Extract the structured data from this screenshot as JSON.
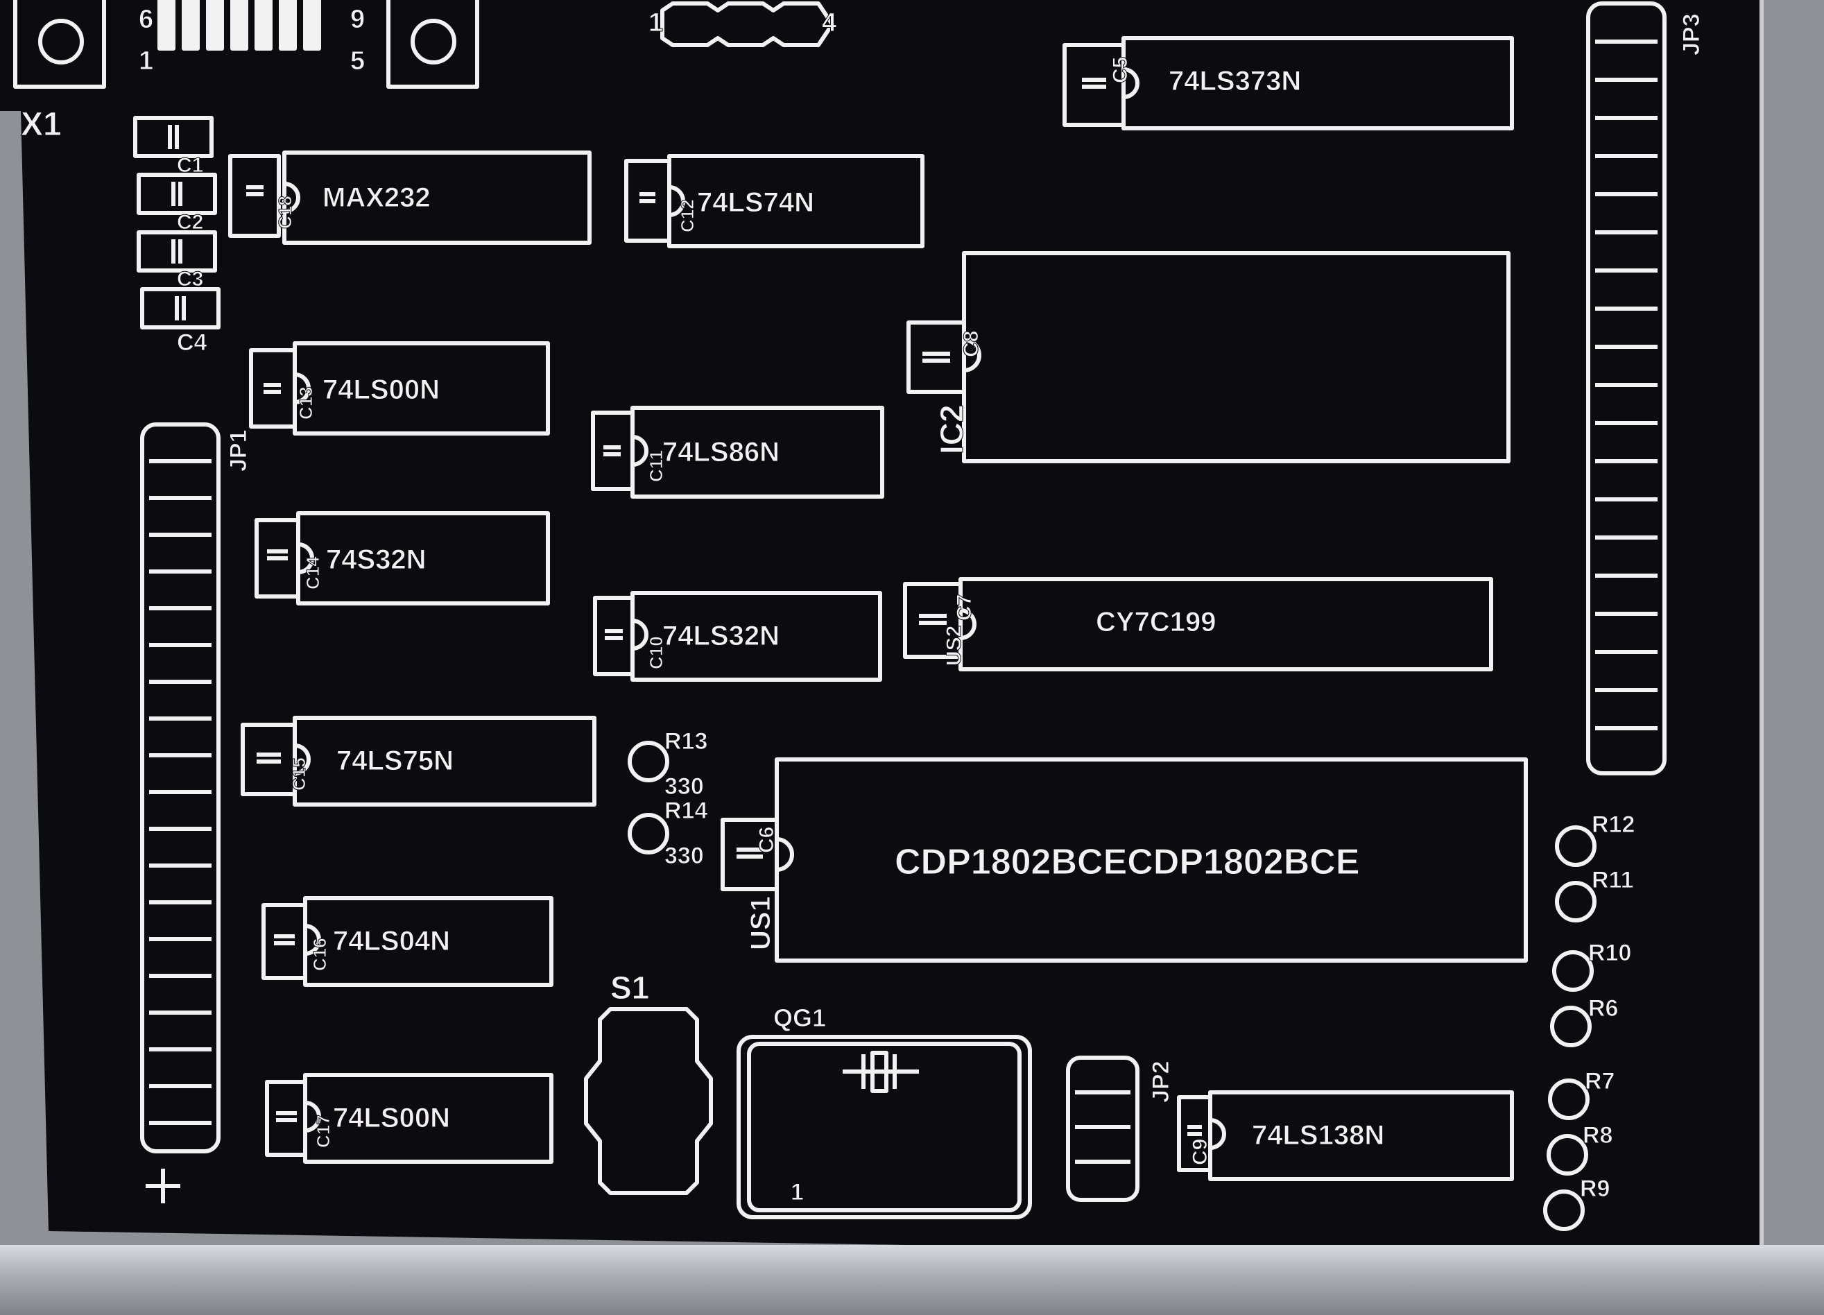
{
  "colors": {
    "board": "#0c0b0f",
    "silk": "#f2f2f2",
    "screen_edge": "#c9ccd1",
    "frame": "#9aa0a6"
  },
  "header_pins": {
    "left_top": "6",
    "left_bottom": "1",
    "right_top": "9",
    "right_bottom": "5",
    "strip_left": "1",
    "strip_right": "4"
  },
  "labels": {
    "x1": "X1",
    "jp1": "JP1",
    "jp2": "JP2",
    "jp3": "JP3",
    "s1": "S1",
    "qg1": "QG1",
    "qg1_pin": "1",
    "ic2": "IC2",
    "us1": "US1",
    "us2": "US2",
    "c1": "C1",
    "c2": "C2",
    "c3": "C3",
    "c4": "C4",
    "c8": "C8",
    "c7": "C7",
    "c6": "C6",
    "c5": "C5",
    "c9": "C9",
    "c10": "C10",
    "c11": "C11",
    "c12": "C12",
    "c13": "C13",
    "c14": "C14",
    "c15": "C15",
    "c16": "C16",
    "c17": "C17",
    "c18": "C18",
    "r13": "R13",
    "r14": "R14",
    "r12": "R12",
    "r11": "R11",
    "r10": "R10",
    "r6": "R6",
    "r7": "R7",
    "r8": "R8",
    "r9": "R9",
    "val330a": "330",
    "val330b": "330"
  },
  "components": [
    {
      "id": "u_max232",
      "name": "MAX232"
    },
    {
      "id": "u_74ls74",
      "name": "74LS74N"
    },
    {
      "id": "u_74ls373",
      "name": "74LS373N"
    },
    {
      "id": "u_74ls00a",
      "name": "74LS00N"
    },
    {
      "id": "u_74ls86",
      "name": "74LS86N"
    },
    {
      "id": "u_74s32",
      "name": "74S32N"
    },
    {
      "id": "u_74ls32",
      "name": "74LS32N"
    },
    {
      "id": "u_cy7c199",
      "name": "CY7C199"
    },
    {
      "id": "u_74ls75",
      "name": "74LS75N"
    },
    {
      "id": "u_cdp1802",
      "name": "CDP1802BCECDP1802BCE"
    },
    {
      "id": "u_74ls04",
      "name": "74LS04N"
    },
    {
      "id": "u_74ls00b",
      "name": "74LS00N"
    },
    {
      "id": "u_74ls138",
      "name": "74LS138N"
    }
  ]
}
